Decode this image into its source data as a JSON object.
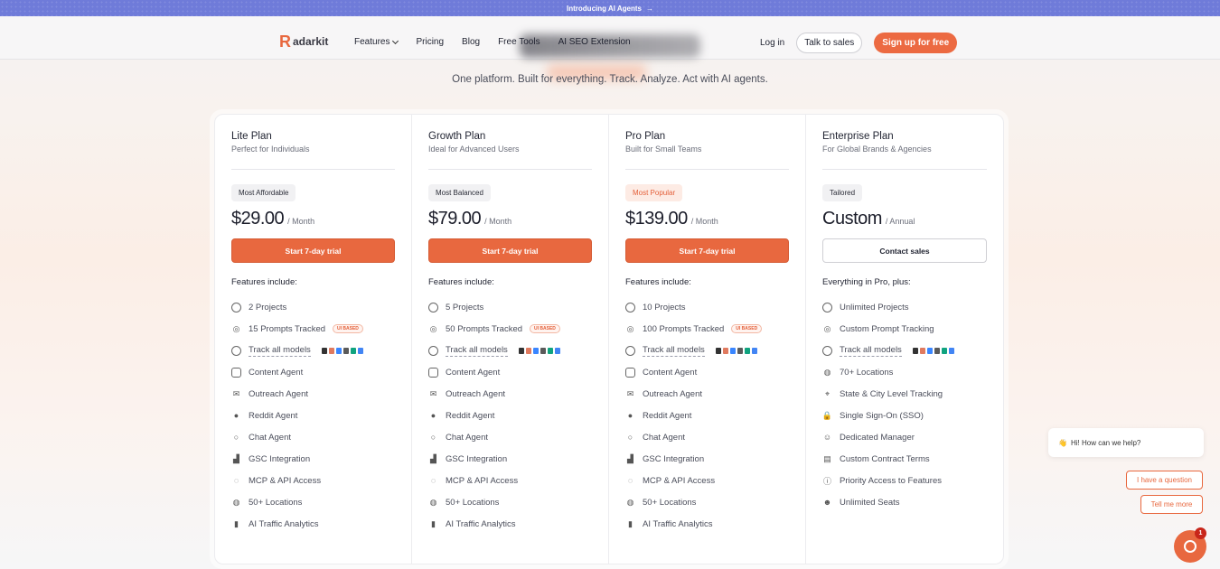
{
  "announcement": {
    "text": "Introducing AI Agents",
    "arrow": "→"
  },
  "nav": {
    "logo_mark": "R",
    "logo_text": "adarkit",
    "links": [
      "Features",
      "Pricing",
      "Blog",
      "Free Tools",
      "AI SEO Extension"
    ],
    "login": "Log in",
    "talk_to_sales": "Talk to sales",
    "signup": "Sign up for free"
  },
  "tagline": "One platform. Built for everything. Track. Analyze. Act with AI agents.",
  "colors": {
    "accent": "#e8683f",
    "announce_bg": "#6f7bd9"
  },
  "plans": [
    {
      "name": "Lite Plan",
      "sub": "Perfect for Individuals",
      "badge": "Most Affordable",
      "price": "$29.00",
      "period": "/ Month",
      "cta": "Start 7-day trial",
      "features_head": "Features include:",
      "features": [
        "2 Projects",
        "15 Prompts Tracked",
        "Track all models",
        "Content Agent",
        "Outreach Agent",
        "Reddit Agent",
        "Chat Agent",
        "GSC Integration",
        "MCP & API Access",
        "50+ Locations",
        "AI Traffic Analytics"
      ]
    },
    {
      "name": "Growth Plan",
      "sub": "Ideal for Advanced Users",
      "badge": "Most Balanced",
      "price": "$79.00",
      "period": "/ Month",
      "cta": "Start 7-day trial",
      "features_head": "Features include:",
      "features": [
        "5 Projects",
        "50 Prompts Tracked",
        "Track all models",
        "Content Agent",
        "Outreach Agent",
        "Reddit Agent",
        "Chat Agent",
        "GSC Integration",
        "MCP & API Access",
        "50+ Locations",
        "AI Traffic Analytics"
      ]
    },
    {
      "name": "Pro Plan",
      "sub": "Built for Small Teams",
      "badge": "Most Popular",
      "price": "$139.00",
      "period": "/ Month",
      "cta": "Start 7-day trial",
      "features_head": "Features include:",
      "features": [
        "10 Projects",
        "100 Prompts Tracked",
        "Track all models",
        "Content Agent",
        "Outreach Agent",
        "Reddit Agent",
        "Chat Agent",
        "GSC Integration",
        "MCP & API Access",
        "50+ Locations",
        "AI Traffic Analytics"
      ]
    },
    {
      "name": "Enterprise Plan",
      "sub": "For Global Brands & Agencies",
      "badge": "Tailored",
      "price": "Custom",
      "period": "/ Annual",
      "cta": "Contact sales",
      "features_head": "Everything in Pro, plus:",
      "features": [
        "Unlimited Projects",
        "Custom Prompt Tracking",
        "Track all models",
        "70+ Locations",
        "State & City Level Tracking",
        "Single Sign-On (SSO)",
        "Dedicated Manager",
        "Custom Contract Terms",
        "Priority Access to Features",
        "Unlimited Seats"
      ]
    }
  ],
  "ui_badge": "UI BASED",
  "chat": {
    "greeting": "Hi! How can we help?",
    "emoji": "👋",
    "option1": "I have a question",
    "option2": "Tell me more",
    "notification_count": "1"
  }
}
